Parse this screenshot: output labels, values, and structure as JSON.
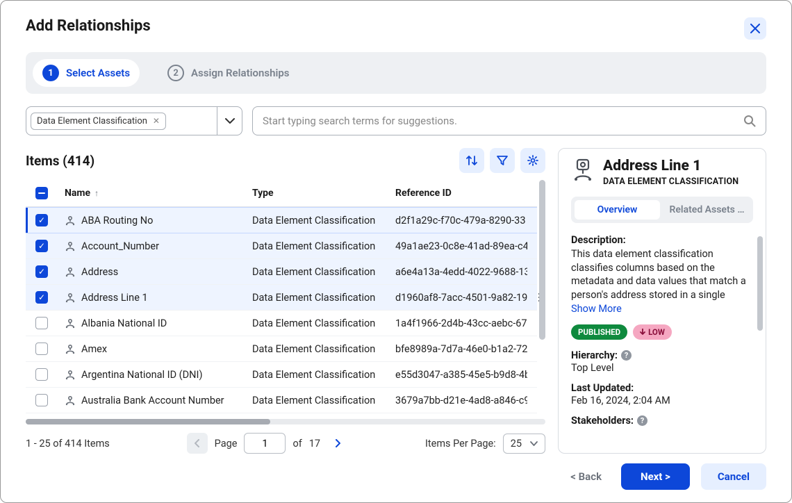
{
  "modal": {
    "title": "Add Relationships"
  },
  "steps": [
    {
      "num": "1",
      "label": "Select Assets"
    },
    {
      "num": "2",
      "label": "Assign Relationships"
    }
  ],
  "filter": {
    "chip": "Data Element Classification"
  },
  "search": {
    "placeholder": "Start typing search terms for suggestions."
  },
  "items_header": "Items (414)",
  "columns": {
    "name": "Name",
    "type": "Type",
    "ref": "Reference ID"
  },
  "rows": [
    {
      "checked": true,
      "name": "ABA Routing No",
      "type": "Data Element Classification",
      "ref": "d2f1a29c-f70c-479a-8290-33",
      "highlighted": true
    },
    {
      "checked": true,
      "name": "Account_Number",
      "type": "Data Element Classification",
      "ref": "49a1ae23-0c8e-41ad-89ea-c4"
    },
    {
      "checked": true,
      "name": "Address",
      "type": "Data Element Classification",
      "ref": "a6e4a13a-4edd-4022-9688-13"
    },
    {
      "checked": true,
      "name": "Address Line 1",
      "type": "Data Element Classification",
      "ref": "d1960af8-7acc-4501-9a82-19",
      "kebab": true
    },
    {
      "checked": false,
      "name": "Albania National ID",
      "type": "Data Element Classification",
      "ref": "1a4f1966-2d4b-43cc-aebc-67"
    },
    {
      "checked": false,
      "name": "Amex",
      "type": "Data Element Classification",
      "ref": "bfe8989a-7d7a-46e0-b1a2-72"
    },
    {
      "checked": false,
      "name": "Argentina National ID (DNI)",
      "type": "Data Element Classification",
      "ref": "e55d3047-a385-45e5-b9d8-4b"
    },
    {
      "checked": false,
      "name": "Australia Bank Account Number",
      "type": "Data Element Classification",
      "ref": "3679a7bb-d21e-4ad8-a846-c9"
    }
  ],
  "paging": {
    "summary": "1 - 25 of 414 Items",
    "page_label": "Page",
    "page": "1",
    "of_label": "of",
    "total_pages": "17",
    "ipp_label": "Items Per Page:",
    "ipp_value": "25"
  },
  "detail": {
    "title": "Address Line 1",
    "subtitle": "DATA ELEMENT CLASSIFICATION",
    "tabs": {
      "overview": "Overview",
      "related": "Related Assets …"
    },
    "desc_label": "Description:",
    "desc_text": "This data element classification classifies columns based on the metadata and data values that match a person's address stored in a single",
    "show_more": "Show More",
    "badges": {
      "published": "PUBLISHED",
      "low": "LOW"
    },
    "hierarchy_label": "Hierarchy:",
    "hierarchy_value": "Top Level",
    "updated_label": "Last Updated:",
    "updated_value": "Feb 16, 2024, 2:04 AM",
    "stakeholders_label": "Stakeholders:"
  },
  "footer": {
    "back": "< Back",
    "next": "Next >",
    "cancel": "Cancel"
  }
}
